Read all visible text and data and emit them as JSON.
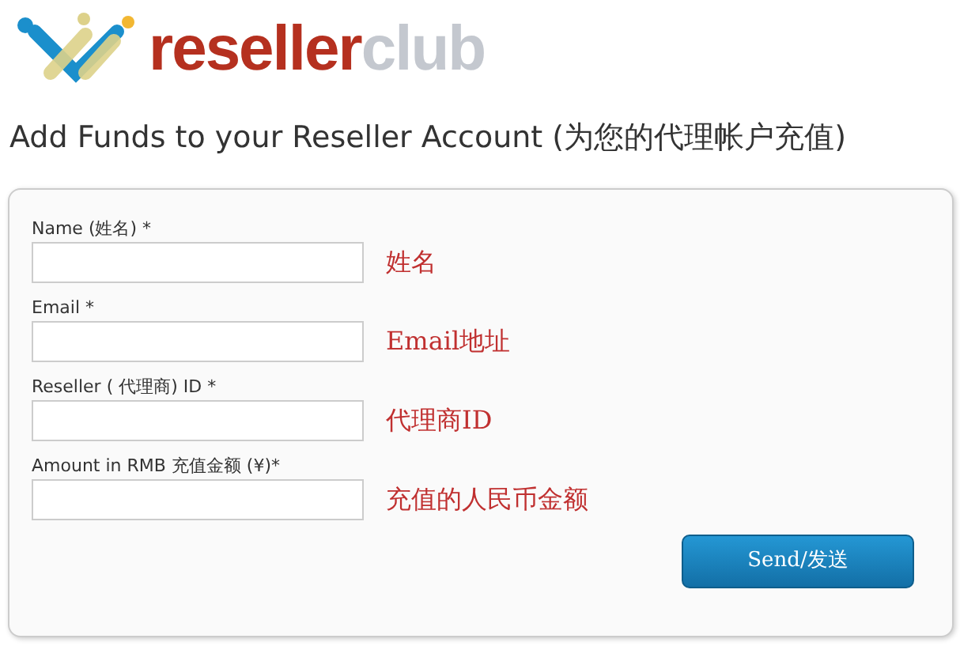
{
  "logo": {
    "primary": "reseller",
    "secondary": "club"
  },
  "heading": {
    "title": "Add Funds to your Reseller Account",
    "subtitle": "(为您的代理帐户充值)"
  },
  "fields": [
    {
      "label": "Name (姓名) *",
      "hint": "姓名"
    },
    {
      "label": "Email *",
      "hint": "Email地址"
    },
    {
      "label": "Reseller ( 代理商) ID *",
      "hint": "代理商ID"
    },
    {
      "label": "Amount in RMB 充值金额 (¥)*",
      "hint": "充值的人民币金额"
    }
  ],
  "submit": {
    "label": "Send/发送"
  }
}
